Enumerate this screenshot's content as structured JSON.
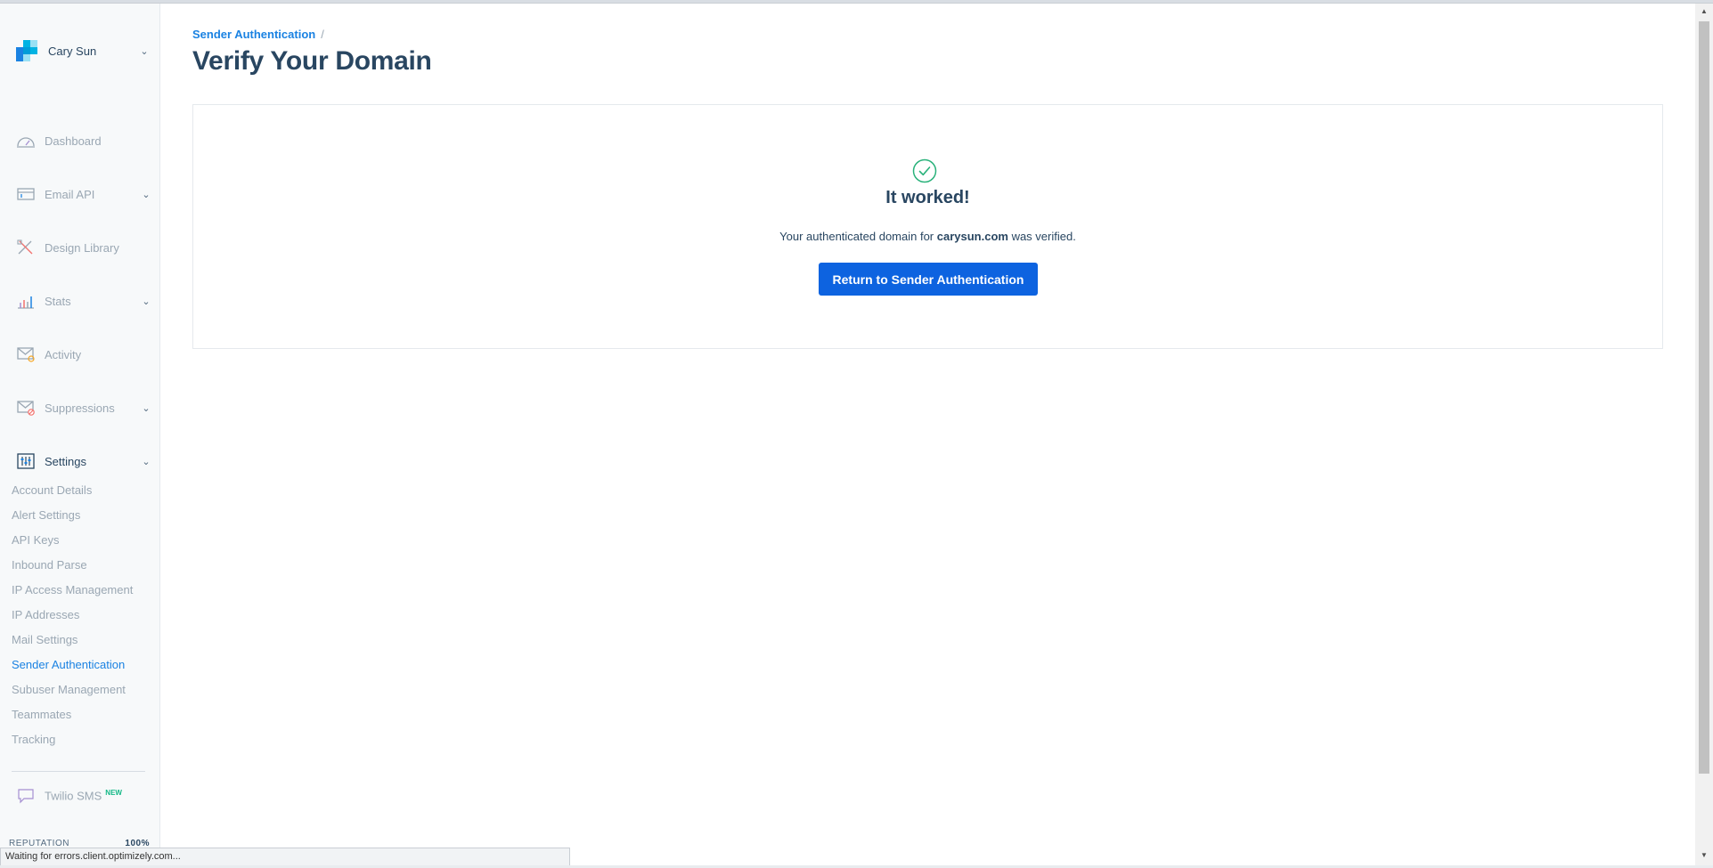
{
  "account": {
    "name": "Cary Sun",
    "menu_icon": "chevron-down-icon"
  },
  "nav": [
    {
      "label": "Dashboard",
      "icon": "dashboard-icon",
      "has_chevron": false
    },
    {
      "label": "Email API",
      "icon": "email-api-icon",
      "has_chevron": true
    },
    {
      "label": "Design Library",
      "icon": "design-library-icon",
      "has_chevron": false
    },
    {
      "label": "Stats",
      "icon": "stats-icon",
      "has_chevron": true
    },
    {
      "label": "Activity",
      "icon": "activity-icon",
      "has_chevron": false
    },
    {
      "label": "Suppressions",
      "icon": "suppressions-icon",
      "has_chevron": true
    },
    {
      "label": "Settings",
      "icon": "settings-icon",
      "has_chevron": true,
      "expanded": true
    }
  ],
  "settings_items": [
    "Account Details",
    "Alert Settings",
    "API Keys",
    "Inbound Parse",
    "IP Access Management",
    "IP Addresses",
    "Mail Settings",
    "Sender Authentication",
    "Subuser Management",
    "Teammates",
    "Tracking"
  ],
  "settings_active": "Sender Authentication",
  "twilio": {
    "label": "Twilio SMS",
    "badge": "NEW"
  },
  "reputation": {
    "label": "REPUTATION",
    "value": "100%"
  },
  "status_bar": "Waiting for errors.client.optimizely.com...",
  "breadcrumb": {
    "link": "Sender Authentication",
    "separator": "/"
  },
  "page_title": "Verify Your Domain",
  "result": {
    "title": "It worked!",
    "message_prefix": "Your authenticated domain for ",
    "domain": "carysun.com",
    "message_suffix": " was verified.",
    "button": "Return to Sender Authentication"
  },
  "colors": {
    "accent": "#1a82e2",
    "button": "#0d63e0",
    "success": "#2ab27b",
    "heading": "#294661",
    "muted": "#9aa7b3"
  }
}
